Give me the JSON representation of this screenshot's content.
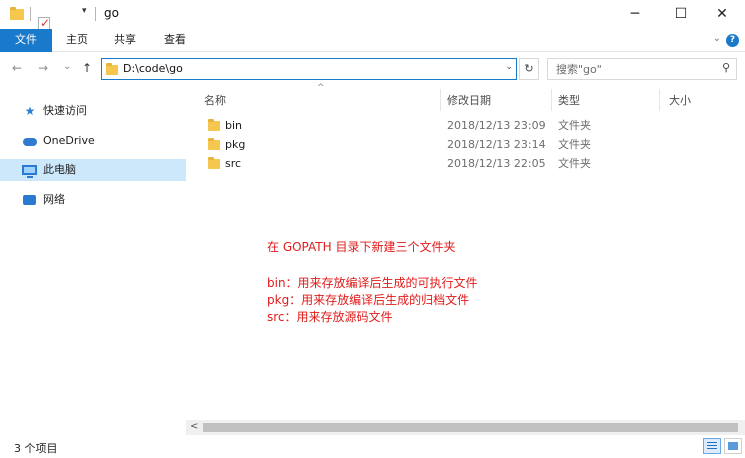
{
  "window": {
    "title": "go",
    "controls": {
      "minimize": "─",
      "maximize": "☐",
      "close": "✕"
    }
  },
  "quick_access_toolbar": {
    "dropdown": "▾"
  },
  "ribbon": {
    "tabs": [
      "文件",
      "主页",
      "共享",
      "查看"
    ],
    "accent": "#1979ca",
    "expand": "⌄",
    "help": "?"
  },
  "navigation": {
    "back": "←",
    "forward": "→",
    "recent": "⌄",
    "up": "↑",
    "address": "D:\\code\\go",
    "address_dropdown": "⌄",
    "refresh": "↻",
    "search_placeholder": "搜索\"go\"",
    "search_icon": "⚲"
  },
  "sidebar": {
    "items": [
      {
        "label": "快速访问",
        "icon": "star-icon"
      },
      {
        "label": "OneDrive",
        "icon": "cloud-icon"
      },
      {
        "label": "此电脑",
        "icon": "computer-icon",
        "selected": true
      },
      {
        "label": "网络",
        "icon": "network-icon"
      }
    ]
  },
  "file_list": {
    "sort_indicator": "^",
    "columns": [
      "名称",
      "修改日期",
      "类型",
      "大小"
    ],
    "rows": [
      {
        "name": "bin",
        "date": "2018/12/13 23:09",
        "type": "文件夹"
      },
      {
        "name": "pkg",
        "date": "2018/12/13 23:14",
        "type": "文件夹"
      },
      {
        "name": "src",
        "date": "2018/12/13 22:05",
        "type": "文件夹"
      }
    ]
  },
  "annotation": {
    "color": "#e21b1b",
    "heading": "在 GOPATH 目录下新建三个文件夹",
    "lines": [
      "bin：用来存放编译后生成的可执行文件",
      "pkg：用来存放编译后生成的归档文件",
      "src：用来存放源码文件"
    ]
  },
  "scrollbar": {
    "left_arrow": "<"
  },
  "status_bar": {
    "item_count": "3 个项目"
  }
}
